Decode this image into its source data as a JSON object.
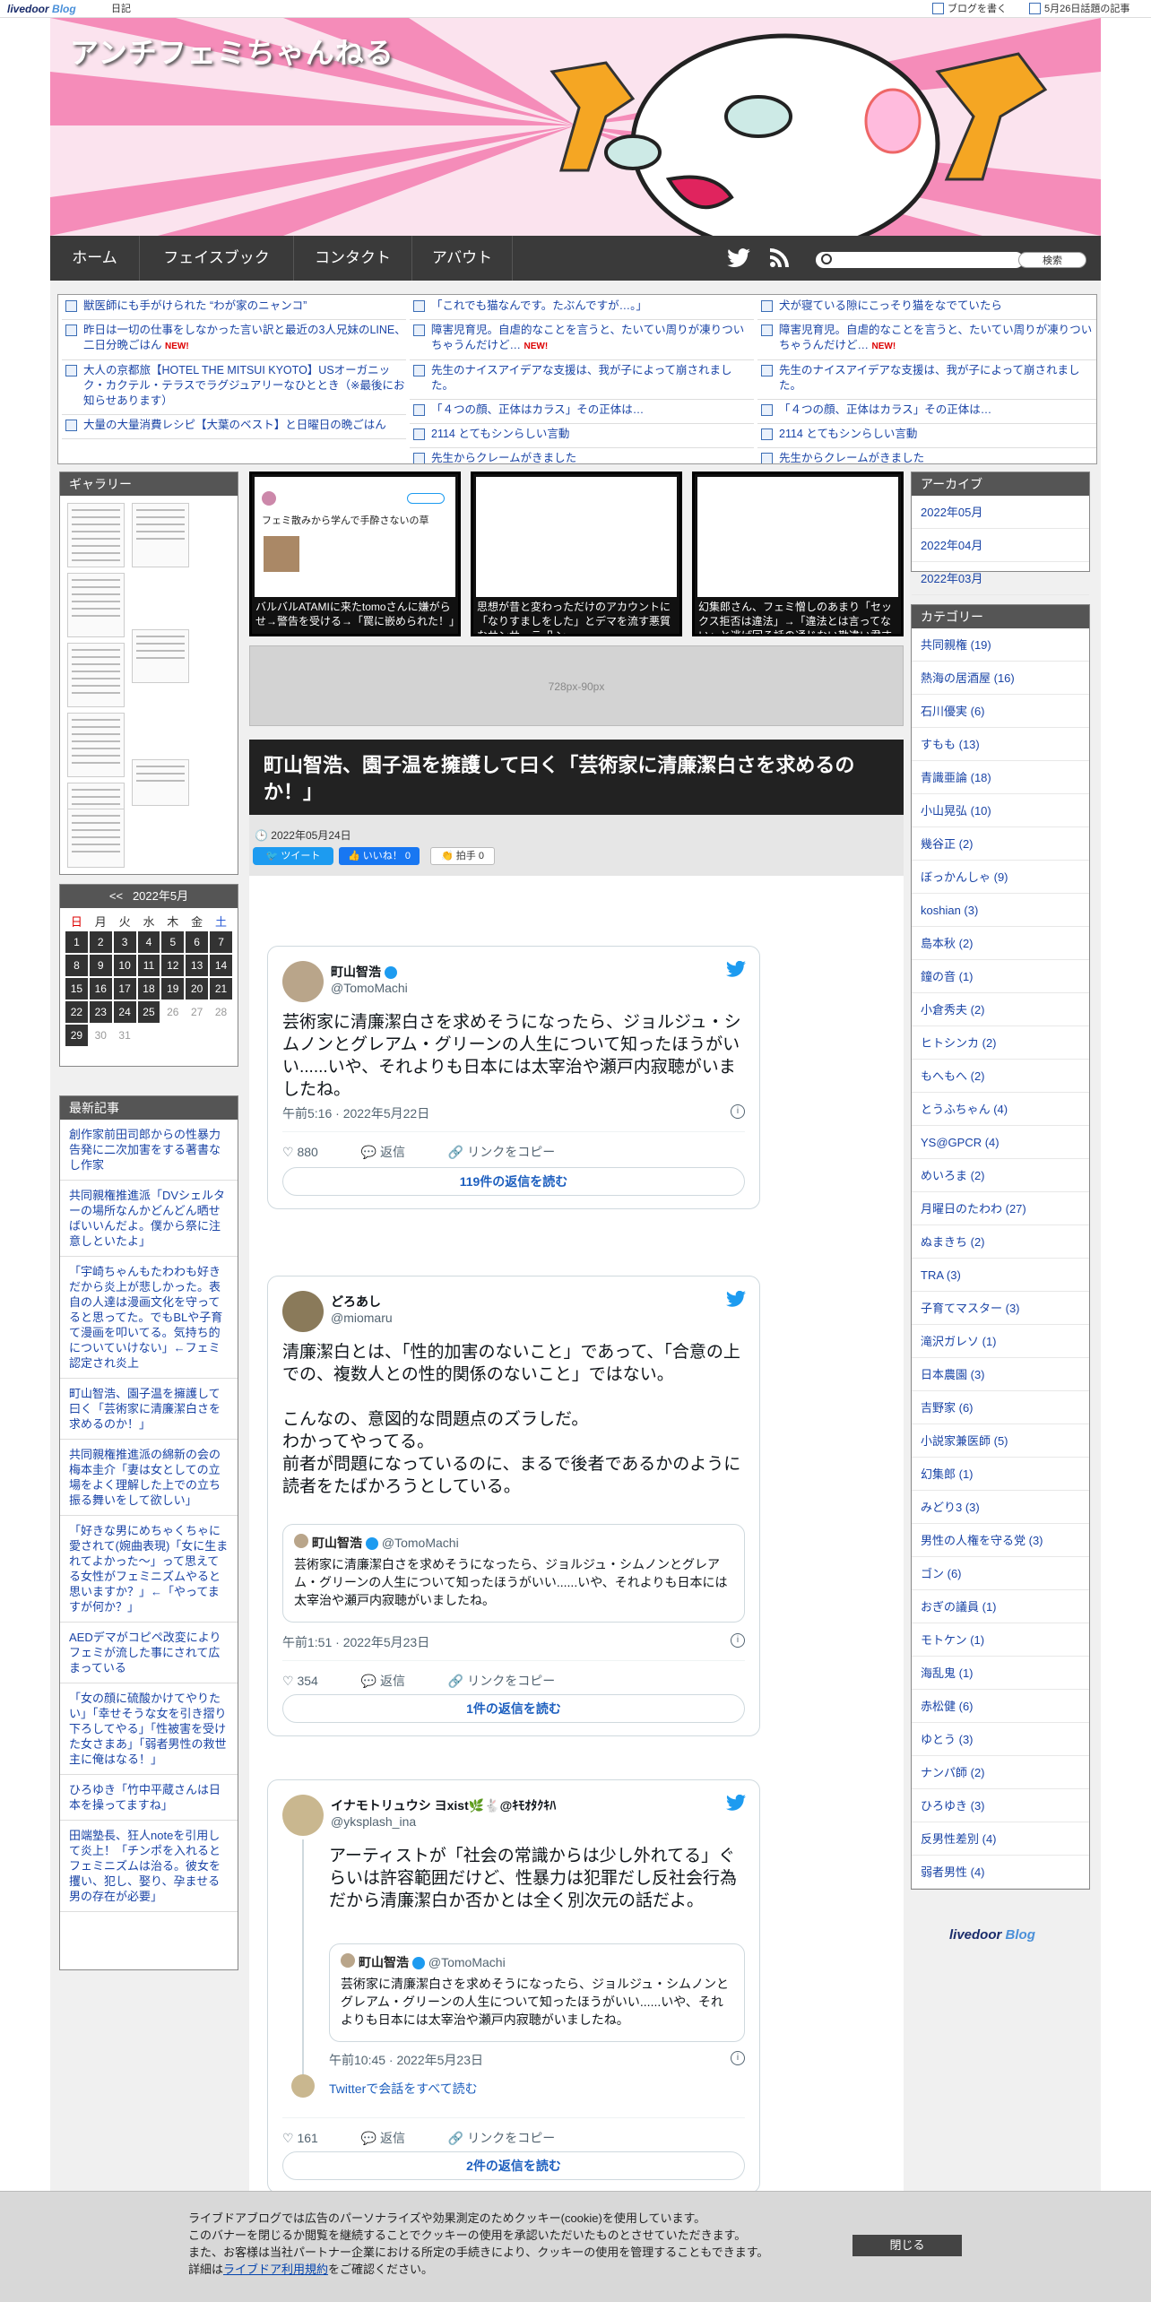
{
  "topbar": {
    "logo_main": "livedoor",
    "logo_sub": "Blog",
    "diary": "日記",
    "write": "ブログを書く",
    "topic": "5月26日話題の記事"
  },
  "blog": {
    "title": "アンチフェミちゃんねる"
  },
  "nav": {
    "items": [
      "ホーム",
      "フェイスブック",
      "コンタクト",
      "アバウト"
    ],
    "search_button": "検索"
  },
  "toplinks": {
    "col1": [
      {
        "text": "獣医師にも手がけられた “わが家のニャンコ”",
        "new": ""
      },
      {
        "text": "昨日は一切の仕事をしなかった言い訳と最近の3人兄妹のLINE、二日分晩ごはん",
        "new": "NEW!"
      },
      {
        "text": "大人の京都旅【HOTEL THE MITSUI KYOTO】USオーガニック・カクテル・テラスでラグジュアリーなひととき（※最後にお知らせあります）",
        "new": ""
      },
      {
        "text": "大量の大量消費レシピ【大葉のベスト】と日曜日の晩ごはん",
        "new": ""
      }
    ],
    "col2": [
      {
        "text": "「これでも猫なんです。たぶんですが…。」",
        "new": ""
      },
      {
        "text": "障害児育児。自虐的なことを言うと、たいてい周りが凍りつい ちゃうんだけど…",
        "new": "NEW!"
      },
      {
        "text": "先生のナイスアイデアな支援は、我が子によって崩されました。",
        "new": ""
      },
      {
        "text": "「４つの顔、正体はカラス」その正体は…",
        "new": ""
      },
      {
        "text": "2114 とてもシンらしい言動",
        "new": ""
      },
      {
        "text": "先生からクレームがきました",
        "new": ""
      }
    ],
    "col3": [
      {
        "text": "犬が寝ている隙にこっそり猫をなでていたら",
        "new": ""
      },
      {
        "text": "障害児育児。自虐的なことを言うと、たいてい周りが凍りつい ちゃうんだけど…",
        "new": "NEW!"
      },
      {
        "text": "先生のナイスアイデアな支援は、我が子によって崩されました。",
        "new": ""
      },
      {
        "text": "「４つの顔、正体はカラス」その正体は…",
        "new": ""
      },
      {
        "text": "2114 とてもシンらしい言動",
        "new": ""
      },
      {
        "text": "先生からクレームがきました",
        "new": ""
      }
    ]
  },
  "gallery": {
    "heading": "ギャラリー"
  },
  "calendar": {
    "prev": "<<",
    "title": "2022年5月",
    "weekdays": [
      "日",
      "月",
      "火",
      "水",
      "木",
      "金",
      "土"
    ],
    "rows": [
      [
        "1",
        "2",
        "3",
        "4",
        "5",
        "6",
        "7"
      ],
      [
        "8",
        "9",
        "10",
        "11",
        "12",
        "13",
        "14"
      ],
      [
        "15",
        "16",
        "17",
        "18",
        "19",
        "20",
        "21"
      ],
      [
        "22",
        "23",
        "24",
        "25",
        "26",
        "27",
        "28"
      ],
      [
        "29",
        "30",
        "31",
        "",
        "",
        "",
        ""
      ]
    ]
  },
  "recent": {
    "heading": "最新記事",
    "items": [
      "創作家前田司郎からの性暴力告発に二次加害をする著書なし作家",
      "共同親権推進派「DVシェルターの場所なんかどんどん晒せばいいんだよ。僕から祭に注意しといたよ」",
      "「宇崎ちゃんもたわわも好きだから炎上が悲しかった。表自の人達は漫画文化を守ってると思ってた。でもBLや子育て漫画を叩いてる。気持ち的についていけない」←フェミ認定され炎上",
      "町山智浩、園子温を擁護して曰く「芸術家に清廉潔白さを求めるのか！」",
      "共同親権推進派の綿新の会の梅本圭介「妻は女としての立場をよく理解した上での立ち振る舞いをして欲しい」",
      "「好きな男にめちゃくちゃに愛されて(婉曲表現)「女に生まれてよかった〜」って思えてる女性がフェミニズムやると思いますか？」←「やってますが何か？」",
      "AEDデマがコピペ改変によりフェミが流した事にされて広まっている",
      "「女の顔に硫酸かけてやりたい」「幸せそうな女を引き摺り下ろしてやる」「性被害を受けた女さまあ」「弱者男性の救世主に俺はなる！」",
      "ひろゆき「竹中平蔵さんは日本を操ってますね」",
      "田端塾長、狂人noteを引用して炎上！「チンポを入れるとフェミニズムは治る。彼女を攫い、犯し、娶り、孕ませる男の存在が必要」"
    ]
  },
  "cards": [
    {
      "caption": "バルバルATAMIに来たtomoさんに嫌がらせ→警告を受ける→「罠に嵌められた！」",
      "tweet_text": "フェミ散みから学んで手酔さないの草"
    },
    {
      "caption": "思想が昔と変わっただけのアカウントに「なりすましをした」とデマを流す悪質なサンサーラ 凸ン",
      "tweet_text": ""
    },
    {
      "caption": "幻集郎さん、フェミ憎しのあまり「セックス拒否は違法」→「違法とは言ってない」と逃げ回る話の通じない勘違い君すぎる",
      "tweet_text": ""
    }
  ],
  "ad": {
    "label": "728px-90px"
  },
  "article": {
    "title": "町山智浩、園子温を擁護して曰く「芸術家に清廉潔白さを求めるのか！」",
    "date": "2022年05月24日",
    "tweet_btn": "ツイート",
    "like_btn": "いいね！ 0",
    "clap_btn": "拍手 0"
  },
  "tweets": [
    {
      "name": "町山智浩",
      "handle": "@TomoMachi",
      "body": "芸術家に清廉潔白さを求めそうになったら、ジョルジュ・シムノンとグレアム・グリーンの人生について知ったほうがいい......いや、それよりも日本には太宰治や瀬戸内寂聴がいましたね。",
      "time": "午前5:16 · 2022年5月22日",
      "likes": "880",
      "reply": "返信",
      "copy": "リンクをコピー",
      "reads": "119件の返信を読む"
    },
    {
      "name": "どろあし",
      "handle": "@miomaru",
      "body": "清廉潔白とは、「性的加害のないこと」であって、「合意の上での、複数人との性的関係のないこと」ではない。\n\nこんなの、意図的な問題点のズラしだ。\nわかってやってる。\n前者が問題になっているのに、まるで後者であるかのように読者をたばかろうとしている。",
      "quote_name": "町山智浩",
      "quote_handle": "@TomoMachi",
      "quote_body": "芸術家に清廉潔白さを求めそうになったら、ジョルジュ・シムノンとグレアム・グリーンの人生について知ったほうがいい......いや、それよりも日本には太宰治や瀬戸内寂聴がいましたね。",
      "time": "午前1:51 · 2022年5月23日",
      "likes": "354",
      "reply": "返信",
      "copy": "リンクをコピー",
      "reads": "1件の返信を読む"
    },
    {
      "name": "イナモトリュウシ ヨxist🌿🐇@ｷﾓｵﾀｸｷﾊ",
      "handle": "@yksplash_ina",
      "body": "アーティストが「社会の常識からは少し外れてる」ぐらいは許容範囲だけど、性暴力は犯罪だし反社会行為だから清廉潔白か否かとは全く別次元の話だよ。",
      "quote_name": "町山智浩",
      "quote_handle": "@TomoMachi",
      "quote_body": "芸術家に清廉潔白さを求めそうになったら、ジョルジュ・シムノンとグレアム・グリーンの人生について知ったほうがいい......いや、それよりも日本には太宰治や瀬戸内寂聴がいましたね。",
      "time": "午前10:45 · 2022年5月23日",
      "thread": "Twitterで会話をすべて読む",
      "likes": "161",
      "reply": "返信",
      "copy": "リンクをコピー",
      "reads": "2件の返信を読む"
    }
  ],
  "archive": {
    "heading": "アーカイブ",
    "items": [
      "2022年05月",
      "2022年04月",
      "2022年03月"
    ]
  },
  "categories": {
    "heading": "カテゴリー",
    "items": [
      "共同親権 (19)",
      "熱海の居酒屋 (16)",
      "石川優実 (6)",
      "すもも (13)",
      "青識亜論 (18)",
      "小山晃弘 (10)",
      "幾谷正 (2)",
      "ぼっかんしゃ (9)",
      "koshian (3)",
      "島本秋 (2)",
      "鐘の音 (1)",
      "小倉秀夫 (2)",
      "ヒトシンカ (2)",
      "もへもへ (2)",
      "とうふちゃん (4)",
      "YS@GPCR (4)",
      "めいろま (2)",
      "月曜日のたわわ (27)",
      "ぬまきち (2)",
      "TRA (3)",
      "子育てマスター (3)",
      "滝沢ガレソ (1)",
      "日本農園 (3)",
      "吉野家 (6)",
      "小説家兼医師 (5)",
      "幻集郎 (1)",
      "みどり3 (3)",
      "男性の人権を守る党 (3)",
      "ゴン (6)",
      "おぎの議員 (1)",
      "モトケン (1)",
      "海乱鬼 (1)",
      "赤松健 (6)",
      "ゆとう (3)",
      "ナンパ師 (2)",
      "ひろゆき (3)",
      "反男性差別 (4)",
      "弱者男性 (4)"
    ]
  },
  "footer_logo": {
    "main": "livedoor",
    "sub": "Blog"
  },
  "cookie": {
    "lines": [
      "ライブドアブログでは広告のパーソナライズや効果測定のためクッキー(cookie)を使用しています。",
      "このバナーを閉じるか閲覧を継続することでクッキーの使用を承認いただいたものとさせていただきます。",
      "また、お客様は当社パートナー企業における所定の手続きにより、クッキーの使用を管理することもできます。"
    ],
    "detail_pre": "詳細は",
    "detail_link": "ライブドア利用規約",
    "detail_post": "をご確認ください。",
    "close": "閉じる"
  }
}
